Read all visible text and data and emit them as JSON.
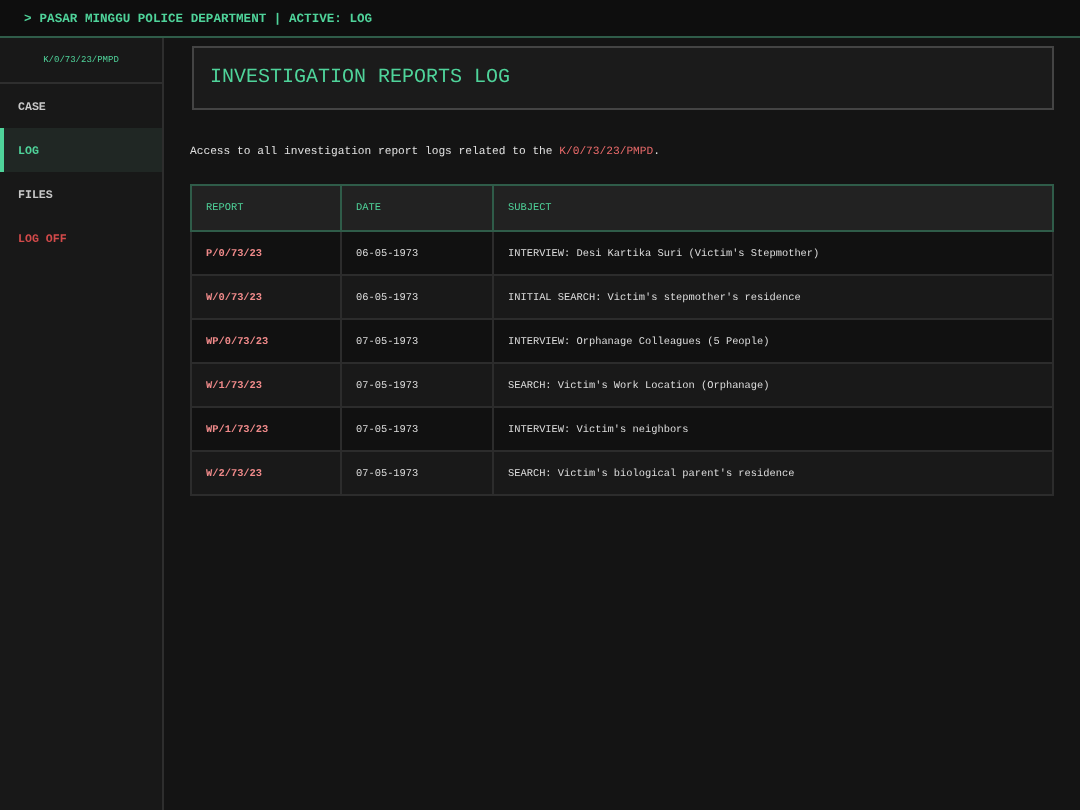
{
  "top_bar": {
    "prompt": ">",
    "title": "PASAR MINGGU POLICE DEPARTMENT | ACTIVE: LOG"
  },
  "sidebar": {
    "case_id": "K/0/73/23/PMPD",
    "items": [
      {
        "label": "CASE",
        "kind": "nav",
        "selected": false
      },
      {
        "label": "LOG",
        "kind": "nav",
        "selected": true
      },
      {
        "label": "FILES",
        "kind": "nav",
        "selected": false
      },
      {
        "label": "LOG OFF",
        "kind": "logout",
        "selected": false
      }
    ]
  },
  "page_title": "INVESTIGATION REPORTS LOG",
  "intro": {
    "before": "Access to all investigation report logs related to the ",
    "case_ref": "K/0/73/23/PMPD",
    "after": "."
  },
  "table": {
    "columns": [
      "REPORT",
      "DATE",
      "SUBJECT"
    ],
    "rows": [
      [
        "P/0/73/23",
        "06-05-1973",
        "INTERVIEW: Desi Kartika Suri (Victim's Stepmother)"
      ],
      [
        "W/0/73/23",
        "06-05-1973",
        "INITIAL SEARCH: Victim's stepmother's residence"
      ],
      [
        "WP/0/73/23",
        "07-05-1973",
        "INTERVIEW: Orphanage Colleagues (5 People)"
      ],
      [
        "W/1/73/23",
        "07-05-1973",
        "SEARCH: Victim's Work Location (Orphanage)"
      ],
      [
        "WP/1/73/23",
        "07-05-1973",
        "INTERVIEW: Victim's neighbors"
      ],
      [
        "W/2/73/23",
        "07-05-1973",
        "SEARCH: Victim's biological parent's residence"
      ]
    ]
  }
}
